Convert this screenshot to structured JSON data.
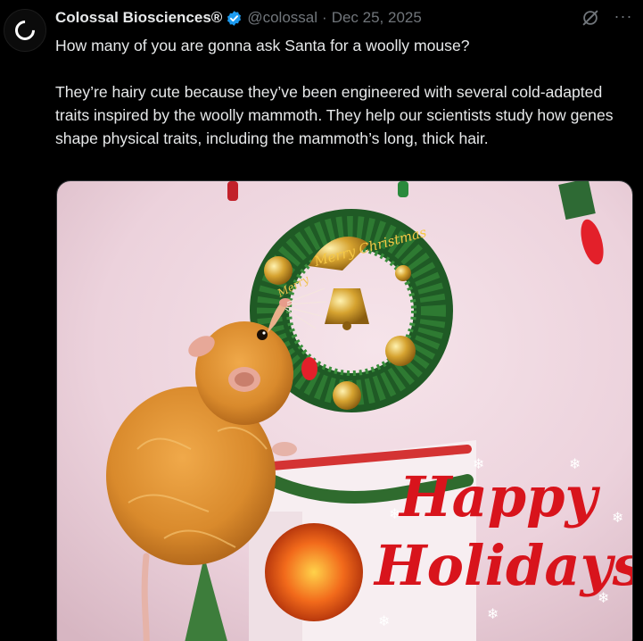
{
  "post": {
    "author_name": "Colossal Biosciences®",
    "handle": "@colossal",
    "separator": "·",
    "date": "Dec 25, 2025",
    "text": "How many of you are gonna ask Santa for a woolly mouse?\n\nThey’re hairy cute because they’ve been engineered with several cold-adapted traits inspired by the woolly mammoth. They help our scientists study how genes shape physical traits, including the mammoth’s long, thick hair.",
    "more_glyph": "···"
  },
  "media": {
    "greeting_line1": "Happy",
    "greeting_line2": "Holidays",
    "wreath_ribbon": "Merry Christmas",
    "wreath_ribbon_left": "Merry"
  },
  "colors": {
    "background": "#000000",
    "text": "#e7e9ea",
    "muted": "#71767b",
    "verified": "#1d9bf0",
    "greeting": "#d8141c"
  },
  "icons": {
    "avatar": "colossal-logo-icon",
    "verified": "verified-badge-icon",
    "grok": "grok-icon",
    "more": "more-icon"
  }
}
